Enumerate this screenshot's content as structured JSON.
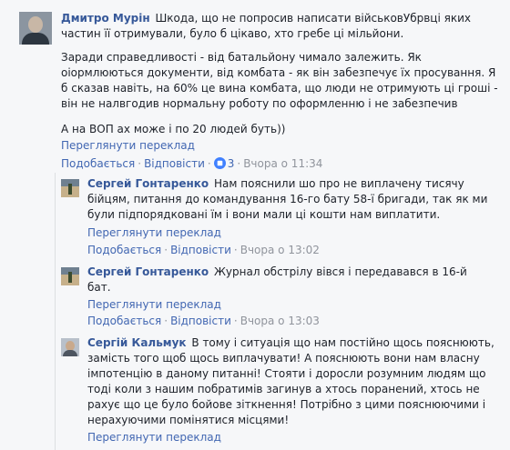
{
  "comments": [
    {
      "author": "Дмитро Мурін",
      "text_lines": [
        "Шкода, що не попросив написати військовУбрвці яких частин її отримували, було б цікаво, хто гребе ці мільйони."
      ],
      "paragraph2": "Заради справедливості - від батальйону чимало залежить. Як оіормлюються документи, від комбата - як він забезпечує їх просування. Я б сказав навіть, на 60% це вина комбата, що люди не отримують ці гроші - він не налвгодив нормальну роботу по оформленню і не забезпечив",
      "paragraph3": "А на ВОП ах може і по 20 людей буть))",
      "see_translation": "Переглянути переклад",
      "like": "Подобається",
      "reply": "Відповісти",
      "reactions": "3",
      "time": "Вчора о 11:34"
    },
    {
      "author": "Сергей Гонтаренко",
      "text": "Нам пояснили шо про не виплачену тисячу бійцям, питання до командування 16-го бату 58-ї бригади, так як ми були підпорядковані їм і вони мали ці кошти нам виплатити.",
      "see_translation": "Переглянути переклад",
      "like": "Подобається",
      "reply": "Відповісти",
      "time": "Вчора о 13:02"
    },
    {
      "author": "Сергей Гонтаренко",
      "text": "Журнал обстрілу вівся і передавався в 16-й бат.",
      "see_translation": "Переглянути переклад",
      "like": "Подобається",
      "reply": "Відповісти",
      "time": "Вчора о 13:03"
    },
    {
      "author": "Сергій Кальмук",
      "text": "В тому і ситуація що нам постійно щось пояснюють, замість того щоб щось виплачувати! А пояснюють вони нам власну імпотенцію в даному питанні! Стояти і доросли розумним людям що тоді коли з нашим побратимів загинув а хтось поранений, хтось не рахує що це було бойове зіткнення! Потрібно з цими пояснюючими і нерахуючими помінятися місцями!",
      "see_translation": "Переглянути переклад"
    }
  ],
  "colors": {
    "link": "#4267b2",
    "author": "#365899",
    "meta": "#90949c",
    "reaction": "#4080ff"
  }
}
